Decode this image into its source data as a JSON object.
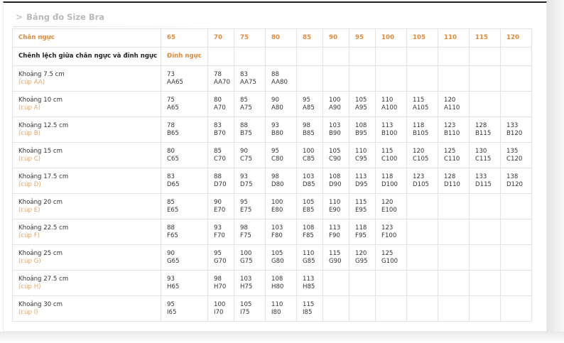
{
  "title": "Bảng đo Size Bra",
  "header": {
    "label": "Chân ngực",
    "bands": [
      "65",
      "70",
      "75",
      "80",
      "85",
      "90",
      "95",
      "100",
      "105",
      "110",
      "115",
      "120"
    ]
  },
  "subheader": {
    "label": "Chênh lệch giữa chân ngực và đỉnh ngực",
    "value": "Đỉnh ngực"
  },
  "rows": [
    {
      "measure": "Khoảng 7.5 cm",
      "cup": "(cúp AA)",
      "cells": [
        {
          "bust": "73",
          "size": "AA65"
        },
        {
          "bust": "78",
          "size": "AA70"
        },
        {
          "bust": "83",
          "size": "AA75"
        },
        {
          "bust": "88",
          "size": "AA80"
        },
        {
          "bust": "",
          "size": ""
        },
        {
          "bust": "",
          "size": ""
        },
        {
          "bust": "",
          "size": ""
        },
        {
          "bust": "",
          "size": ""
        },
        {
          "bust": "",
          "size": ""
        },
        {
          "bust": "",
          "size": ""
        },
        {
          "bust": "",
          "size": ""
        },
        {
          "bust": "",
          "size": ""
        }
      ]
    },
    {
      "measure": "Khoảng 10 cm",
      "cup": "(cúp A)",
      "cells": [
        {
          "bust": "75",
          "size": "A65"
        },
        {
          "bust": "80",
          "size": "A70"
        },
        {
          "bust": "85",
          "size": "A75"
        },
        {
          "bust": "90",
          "size": "A80"
        },
        {
          "bust": "95",
          "size": "A85"
        },
        {
          "bust": "100",
          "size": "A90"
        },
        {
          "bust": "105",
          "size": "A95"
        },
        {
          "bust": "110",
          "size": "A100"
        },
        {
          "bust": "115",
          "size": "A105"
        },
        {
          "bust": "120",
          "size": "A110"
        },
        {
          "bust": "",
          "size": ""
        },
        {
          "bust": "",
          "size": ""
        }
      ]
    },
    {
      "measure": "Khoảng 12.5 cm",
      "cup": "(cúp B)",
      "cells": [
        {
          "bust": "78",
          "size": "B65"
        },
        {
          "bust": "83",
          "size": "B70"
        },
        {
          "bust": "88",
          "size": "B75"
        },
        {
          "bust": "93",
          "size": "B80"
        },
        {
          "bust": "98",
          "size": "B85"
        },
        {
          "bust": "103",
          "size": "B90"
        },
        {
          "bust": "108",
          "size": "B95"
        },
        {
          "bust": "113",
          "size": "B100"
        },
        {
          "bust": "118",
          "size": "B105"
        },
        {
          "bust": "123",
          "size": "B110"
        },
        {
          "bust": "128",
          "size": "B115"
        },
        {
          "bust": "133",
          "size": "B120"
        }
      ]
    },
    {
      "measure": "Khoảng 15 cm",
      "cup": "(cúp C)",
      "cells": [
        {
          "bust": "80",
          "size": "C65"
        },
        {
          "bust": "85",
          "size": "C70"
        },
        {
          "bust": "90",
          "size": "C75"
        },
        {
          "bust": "95",
          "size": "C80"
        },
        {
          "bust": "100",
          "size": "C85"
        },
        {
          "bust": "105",
          "size": "C90"
        },
        {
          "bust": "110",
          "size": "C95"
        },
        {
          "bust": "115",
          "size": "C100"
        },
        {
          "bust": "120",
          "size": "C105"
        },
        {
          "bust": "125",
          "size": "C110"
        },
        {
          "bust": "130",
          "size": "C115"
        },
        {
          "bust": "135",
          "size": "C120"
        }
      ]
    },
    {
      "measure": "Khoảng 17.5 cm",
      "cup": "(cúp D)",
      "cells": [
        {
          "bust": "83",
          "size": "D65"
        },
        {
          "bust": "88",
          "size": "D70"
        },
        {
          "bust": "93",
          "size": "D75"
        },
        {
          "bust": "98",
          "size": "D80"
        },
        {
          "bust": "103",
          "size": "D85"
        },
        {
          "bust": "108",
          "size": "D90"
        },
        {
          "bust": "113",
          "size": "D95"
        },
        {
          "bust": "118",
          "size": "D100"
        },
        {
          "bust": "123",
          "size": "D105"
        },
        {
          "bust": "128",
          "size": "D110"
        },
        {
          "bust": "133",
          "size": "D115"
        },
        {
          "bust": "138",
          "size": "D120"
        }
      ]
    },
    {
      "measure": "Khoảng 20 cm",
      "cup": "(cúp E)",
      "cells": [
        {
          "bust": "85",
          "size": "E65"
        },
        {
          "bust": "90",
          "size": "E70"
        },
        {
          "bust": "95",
          "size": "E75"
        },
        {
          "bust": "100",
          "size": "E80"
        },
        {
          "bust": "105",
          "size": "E85"
        },
        {
          "bust": "110",
          "size": "E90"
        },
        {
          "bust": "115",
          "size": "E95"
        },
        {
          "bust": "120",
          "size": "E100"
        },
        {
          "bust": "",
          "size": ""
        },
        {
          "bust": "",
          "size": ""
        },
        {
          "bust": "",
          "size": ""
        },
        {
          "bust": "",
          "size": ""
        }
      ]
    },
    {
      "measure": "Khoảng 22.5 cm",
      "cup": "(cúp F)",
      "cells": [
        {
          "bust": "88",
          "size": "F65"
        },
        {
          "bust": "93",
          "size": "F70"
        },
        {
          "bust": "98",
          "size": "F75"
        },
        {
          "bust": "103",
          "size": "F80"
        },
        {
          "bust": "108",
          "size": "F85"
        },
        {
          "bust": "113",
          "size": "F90"
        },
        {
          "bust": "118",
          "size": "F95"
        },
        {
          "bust": "123",
          "size": "F100"
        },
        {
          "bust": "",
          "size": ""
        },
        {
          "bust": "",
          "size": ""
        },
        {
          "bust": "",
          "size": ""
        },
        {
          "bust": "",
          "size": ""
        }
      ]
    },
    {
      "measure": "Khoảng 25 cm",
      "cup": "(cúp G)",
      "cells": [
        {
          "bust": "90",
          "size": "G65"
        },
        {
          "bust": "95",
          "size": "G70"
        },
        {
          "bust": "100",
          "size": "G75"
        },
        {
          "bust": "105",
          "size": "G80"
        },
        {
          "bust": "110",
          "size": "G85"
        },
        {
          "bust": "115",
          "size": "G90"
        },
        {
          "bust": "120",
          "size": "G95"
        },
        {
          "bust": "125",
          "size": "G100"
        },
        {
          "bust": "",
          "size": ""
        },
        {
          "bust": "",
          "size": ""
        },
        {
          "bust": "",
          "size": ""
        },
        {
          "bust": "",
          "size": ""
        }
      ]
    },
    {
      "measure": "Khoảng 27.5 cm",
      "cup": "(cúp H)",
      "cells": [
        {
          "bust": "93",
          "size": "H65"
        },
        {
          "bust": "98",
          "size": "H70"
        },
        {
          "bust": "103",
          "size": "H75"
        },
        {
          "bust": "108",
          "size": "H80"
        },
        {
          "bust": "113",
          "size": "H85"
        },
        {
          "bust": "",
          "size": ""
        },
        {
          "bust": "",
          "size": ""
        },
        {
          "bust": "",
          "size": ""
        },
        {
          "bust": "",
          "size": ""
        },
        {
          "bust": "",
          "size": ""
        },
        {
          "bust": "",
          "size": ""
        },
        {
          "bust": "",
          "size": ""
        }
      ]
    },
    {
      "measure": "Khoảng 30 cm",
      "cup": "(cúp I)",
      "cells": [
        {
          "bust": "95",
          "size": "I65"
        },
        {
          "bust": "100",
          "size": "I70"
        },
        {
          "bust": "105",
          "size": "I75"
        },
        {
          "bust": "110",
          "size": "I80"
        },
        {
          "bust": "115",
          "size": "I85"
        },
        {
          "bust": "",
          "size": ""
        },
        {
          "bust": "",
          "size": ""
        },
        {
          "bust": "",
          "size": ""
        },
        {
          "bust": "",
          "size": ""
        },
        {
          "bust": "",
          "size": ""
        },
        {
          "bust": "",
          "size": ""
        },
        {
          "bust": "",
          "size": ""
        }
      ]
    }
  ],
  "colors": {
    "accent": "#e08a3c",
    "cup": "#e3a46a",
    "title": "#b8b8b8",
    "border": "#e3e3e3"
  }
}
